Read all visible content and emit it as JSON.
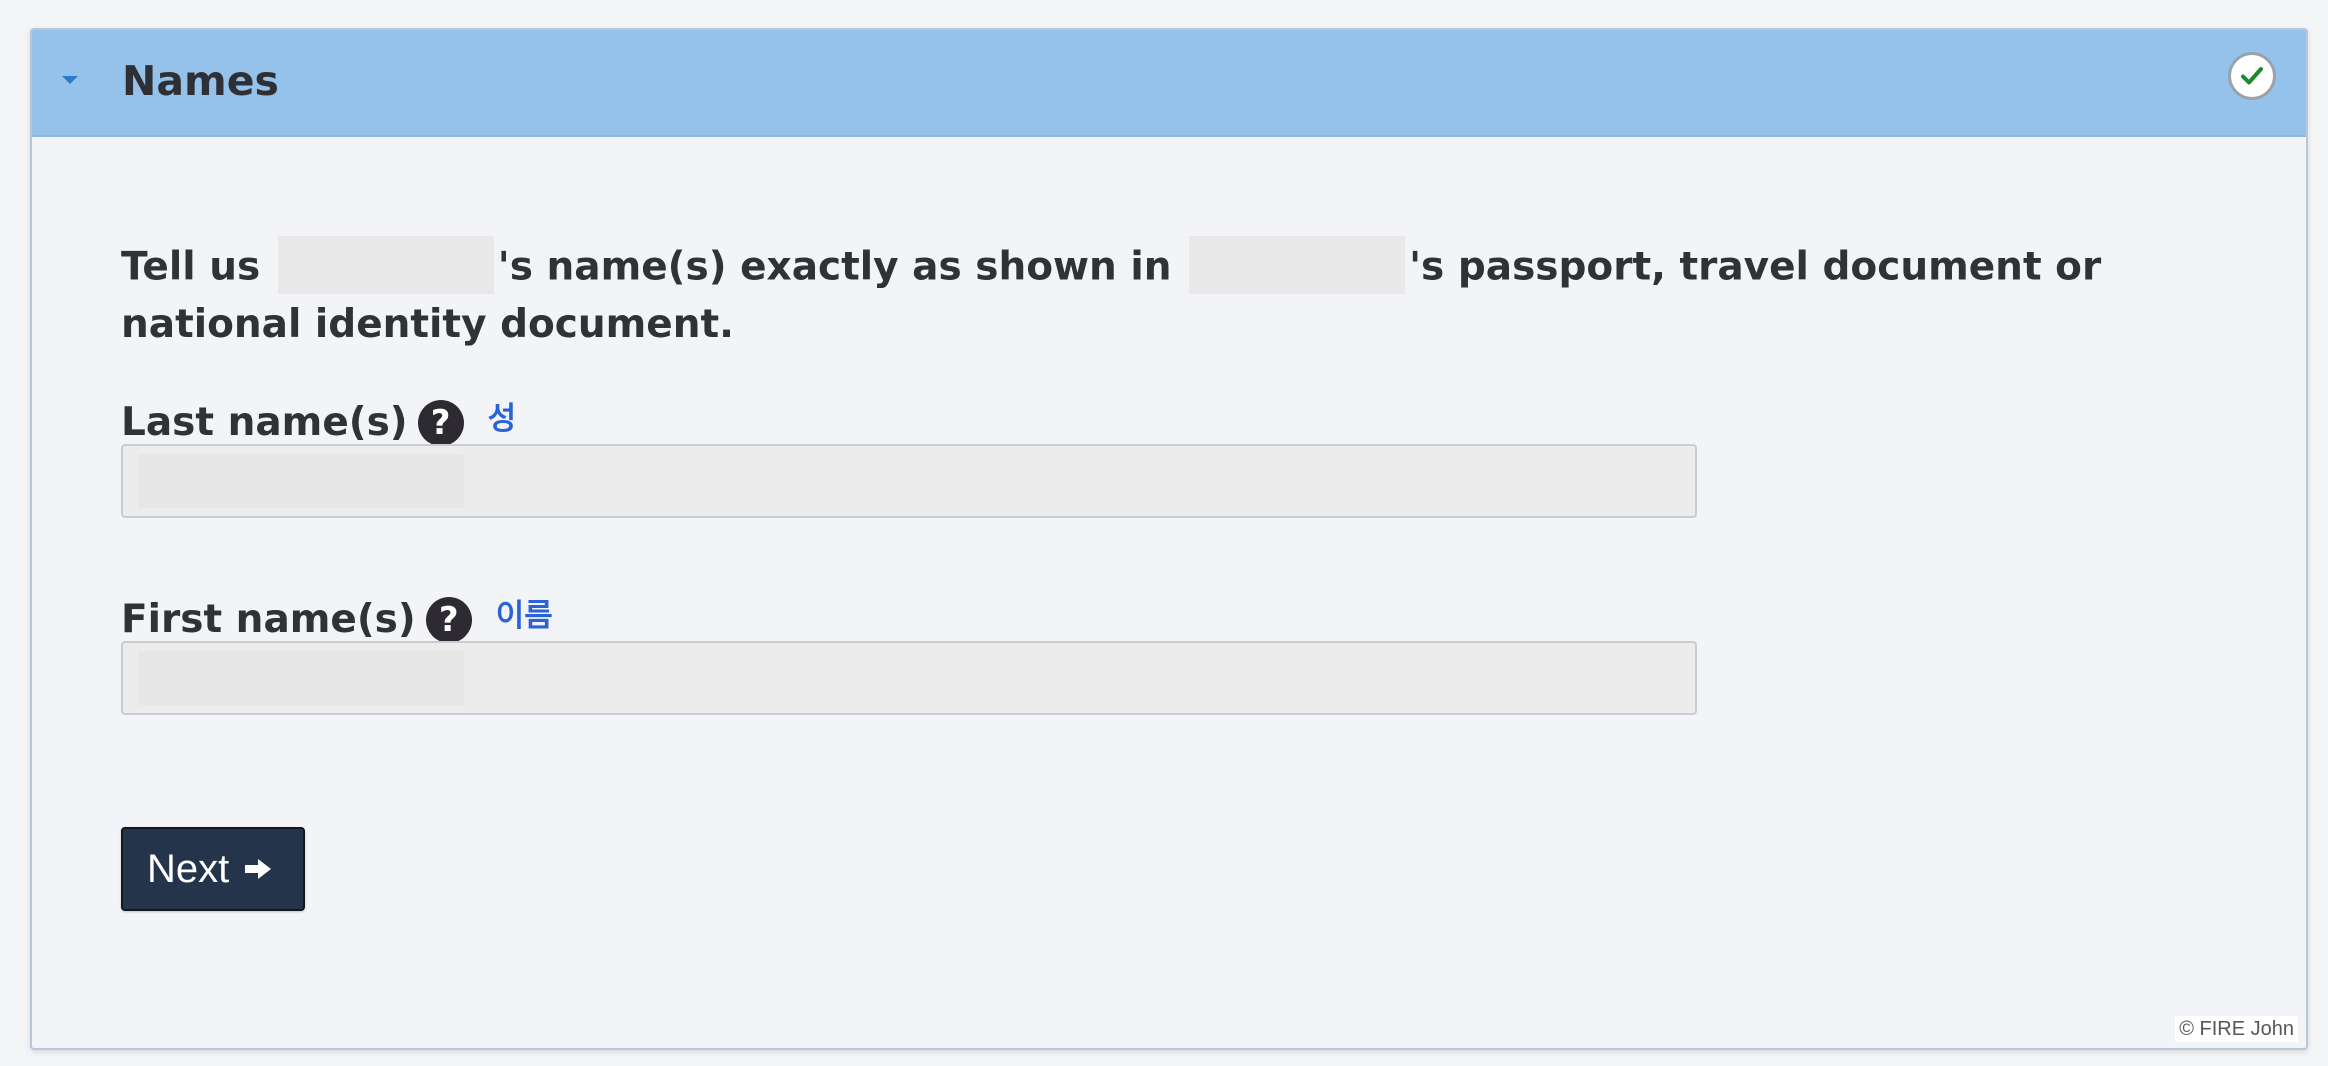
{
  "panel": {
    "title": "Names",
    "status_icon": "check-icon",
    "collapse_icon": "caret-down-icon"
  },
  "intro": {
    "prefix": "Tell us",
    "middle": "'s name(s) exactly as shown in",
    "suffix": "'s passport, travel document or national identity document."
  },
  "fields": {
    "last_name": {
      "label": "Last name(s)",
      "translation": "성",
      "help_icon": "question-circle-icon",
      "value": ""
    },
    "first_name": {
      "label": "First name(s)",
      "translation": "이름",
      "help_icon": "question-circle-icon",
      "value": ""
    }
  },
  "actions": {
    "next_label": "Next",
    "next_icon": "arrow-right-icon"
  },
  "footer": {
    "copyright": "© FIRE John"
  },
  "colors": {
    "header_bg": "#94c2ea",
    "panel_bg": "#f2f4f7",
    "button_bg": "#24344a",
    "translation_blue": "#2a62d7",
    "success_green": "#1d8a2f"
  }
}
